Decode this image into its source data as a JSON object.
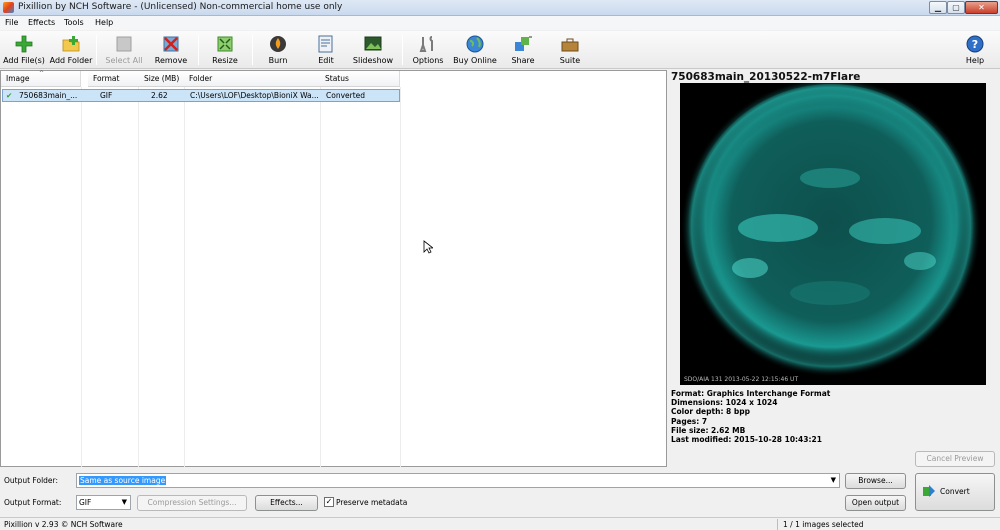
{
  "window": {
    "title": "Pixillion by NCH Software - (Unlicensed) Non-commercial home use only"
  },
  "menu": {
    "items": [
      "File",
      "Effects",
      "Tools",
      "Help"
    ]
  },
  "toolbar": {
    "add_files": "Add File(s)",
    "add_folder": "Add Folder",
    "select_all": "Select All",
    "remove": "Remove",
    "resize": "Resize",
    "burn": "Burn",
    "edit": "Edit",
    "slideshow": "Slideshow",
    "options": "Options",
    "buy_online": "Buy Online",
    "share": "Share",
    "suite": "Suite",
    "help": "Help"
  },
  "table": {
    "columns": [
      "Image",
      "Format",
      "Size (MB)",
      "Folder",
      "Status"
    ],
    "rows": [
      {
        "image": "750683main_...",
        "format": "GIF",
        "size": "2.62",
        "folder": "C:\\Users\\LOF\\Desktop\\BioniX Wa...",
        "status": "Converted"
      }
    ]
  },
  "preview": {
    "title": "750683main_20130522-m7Flare",
    "caption": "SDO/AIA  131   2013-05-22 12:15:46 UT",
    "format": "Format: Graphics Interchange Format",
    "dimensions": "Dimensions: 1024 x 1024",
    "color_depth": "Color depth: 8 bpp",
    "pages": "Pages: 7",
    "file_size": "File size: 2.62 MB",
    "last_modified": "Last modified: 2015-10-28 10:43:21"
  },
  "bottom": {
    "output_folder_label": "Output Folder:",
    "output_folder_value": "Same as source image",
    "browse": "Browse...",
    "cancel_preview": "Cancel Preview",
    "output_format_label": "Output Format:",
    "output_format_value": "GIF",
    "compression": "Compression Settings...",
    "effects": "Effects...",
    "preserve_metadata": "Preserve metadata",
    "open_output": "Open output",
    "convert": "Convert"
  },
  "status": {
    "version": "Pixillion v 2.93 © NCH Software",
    "selection": "1 / 1 images selected"
  },
  "colors": {
    "selection": "#cce4f7",
    "sun": "#1fb6ac",
    "check": "#2e9e2e"
  }
}
